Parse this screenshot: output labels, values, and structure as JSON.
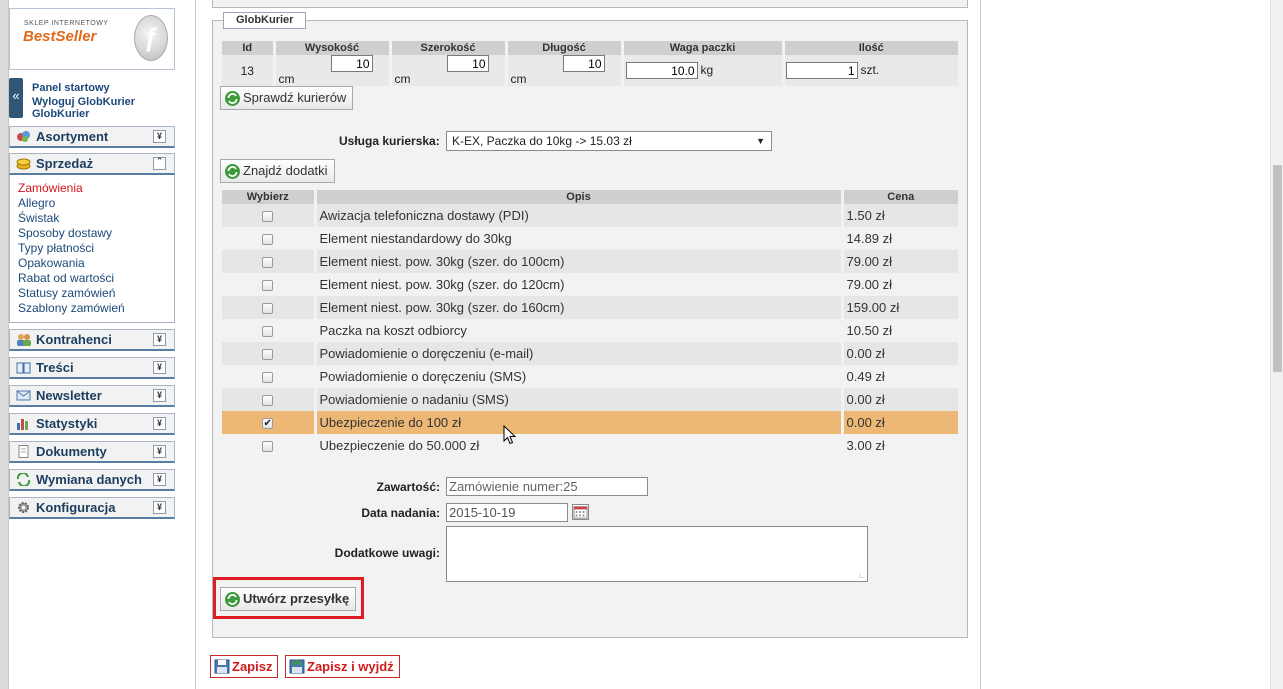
{
  "logo": {
    "small_text": "SKLEP INTERNETOWY",
    "name": "BestSeller"
  },
  "panel": {
    "collapse_glyph": "«",
    "links": [
      "Panel startowy",
      "Wyloguj GlobKurier",
      "GlobKurier"
    ]
  },
  "menu": {
    "asortyment": "Asortyment",
    "sprzedaz": "Sprzedaż",
    "sprzedaz_items": [
      "Zamówienia",
      "Allegro",
      "Świstak",
      "Sposoby dostawy",
      "Typy płatności",
      "Opakowania",
      "Rabat od wartości",
      "Statusy zamówień",
      "Szablony zamówień"
    ],
    "kontrahenci": "Kontrahenci",
    "tresci": "Treści",
    "newsletter": "Newsletter",
    "statystyki": "Statystyki",
    "dokumenty": "Dokumenty",
    "wymiana": "Wymiana danych",
    "konfiguracja": "Konfiguracja",
    "expand_glyph": "¥",
    "collapse_glyph": "«"
  },
  "legend": "GlobKurier",
  "dims": {
    "headers": [
      "Id",
      "Wysokość",
      "Szerokość",
      "Długość",
      "Waga paczki",
      "Ilość"
    ],
    "id": "13",
    "height": "10",
    "height_unit": "cm",
    "width": "10",
    "width_unit": "cm",
    "length": "10",
    "length_unit": "cm",
    "weight": "10.0",
    "weight_unit": "kg",
    "qty": "1",
    "qty_unit": "szt."
  },
  "buttons": {
    "check_couriers": "Sprawdź kurierów",
    "find_addons": "Znajdź dodatki",
    "create_shipment": "Utwórz przesyłkę",
    "save": "Zapisz",
    "save_exit": "Zapisz i wyjdź"
  },
  "service": {
    "label": "Usługa kurierska:",
    "value": "K-EX, Paczka do 10kg -> 15.03 zł",
    "arrow": "▼"
  },
  "addons": {
    "headers": [
      "Wybierz",
      "Opis",
      "Cena"
    ],
    "rows": [
      {
        "desc": "Awizacja telefoniczna dostawy (PDI)",
        "price": "1.50 zł",
        "checked": ""
      },
      {
        "desc": "Element niestandardowy do 30kg",
        "price": "14.89 zł",
        "checked": ""
      },
      {
        "desc": "Element niest. pow. 30kg (szer. do 100cm)",
        "price": "79.00 zł",
        "checked": ""
      },
      {
        "desc": "Element niest. pow. 30kg (szer. do 120cm)",
        "price": "79.00 zł",
        "checked": ""
      },
      {
        "desc": "Element niest. pow. 30kg (szer. do 160cm)",
        "price": "159.00 zł",
        "checked": ""
      },
      {
        "desc": "Paczka na koszt odbiorcy",
        "price": "10.50 zł",
        "checked": ""
      },
      {
        "desc": "Powiadomienie o doręczeniu (e-mail)",
        "price": "0.00 zł",
        "checked": ""
      },
      {
        "desc": "Powiadomienie o doręczeniu (SMS)",
        "price": "0.49 zł",
        "checked": ""
      },
      {
        "desc": "Powiadomienie o nadaniu (SMS)",
        "price": "0.00 zł",
        "checked": ""
      },
      {
        "desc": "Ubezpieczenie do 100 zł",
        "price": "0.00 zł",
        "checked": "✔"
      },
      {
        "desc": "Ubezpieczenie do 50.000 zł",
        "price": "3.00 zł",
        "checked": ""
      }
    ]
  },
  "form": {
    "content_label": "Zawartość:",
    "content_value": "Zamówienie numer:25",
    "date_label": "Data nadania:",
    "date_value": "2015-10-19",
    "notes_label": "Dodatkowe uwagi:",
    "notes_value": ""
  },
  "colors": {
    "selected_row": "#edb876",
    "highlight_box": "#e01b24",
    "active_link": "#d4161e"
  },
  "icons": [
    "refresh-green-icon",
    "calendar-icon",
    "floppy-disk-icon",
    "save-exit-icon",
    "mouse-pointer-icon"
  ]
}
